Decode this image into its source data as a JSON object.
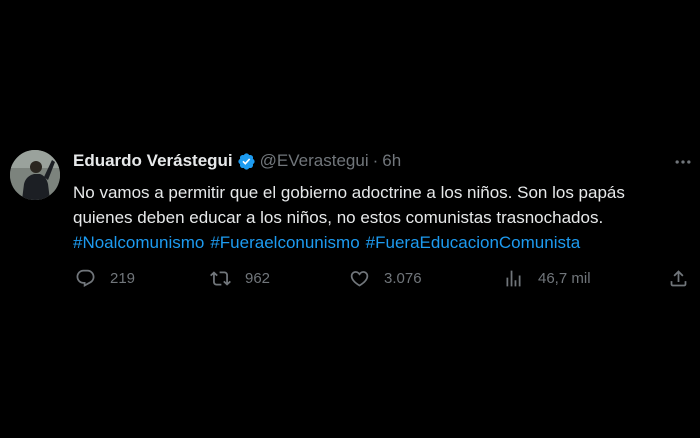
{
  "author": {
    "name": "Eduardo Verástegui",
    "handle": "@EVerastegui",
    "separator": "·",
    "time": "6h",
    "verified": true
  },
  "tweet": {
    "line1": "No vamos a permitir que el gobierno adoctrine a los niños. Son los papás",
    "line2": "quienes deben educar a los niños, no estos comunistas trasnochados.",
    "hashtags": [
      "#Noalcomunismo",
      "#Fueraelconunismo",
      "#FueraEducacionComunista"
    ]
  },
  "metrics": {
    "replies": "219",
    "retweets": "962",
    "likes": "3.076",
    "views": "46,7 mil"
  },
  "colors": {
    "background": "#000000",
    "text": "#e7e9ea",
    "muted": "#71767b",
    "link": "#1d9bf0",
    "verified": "#1d9bf0"
  },
  "icons": {
    "more": "more-horizontal-icon",
    "reply": "reply-icon",
    "retweet": "retweet-icon",
    "like": "heart-icon",
    "views": "views-bar-chart-icon",
    "share": "share-icon"
  }
}
